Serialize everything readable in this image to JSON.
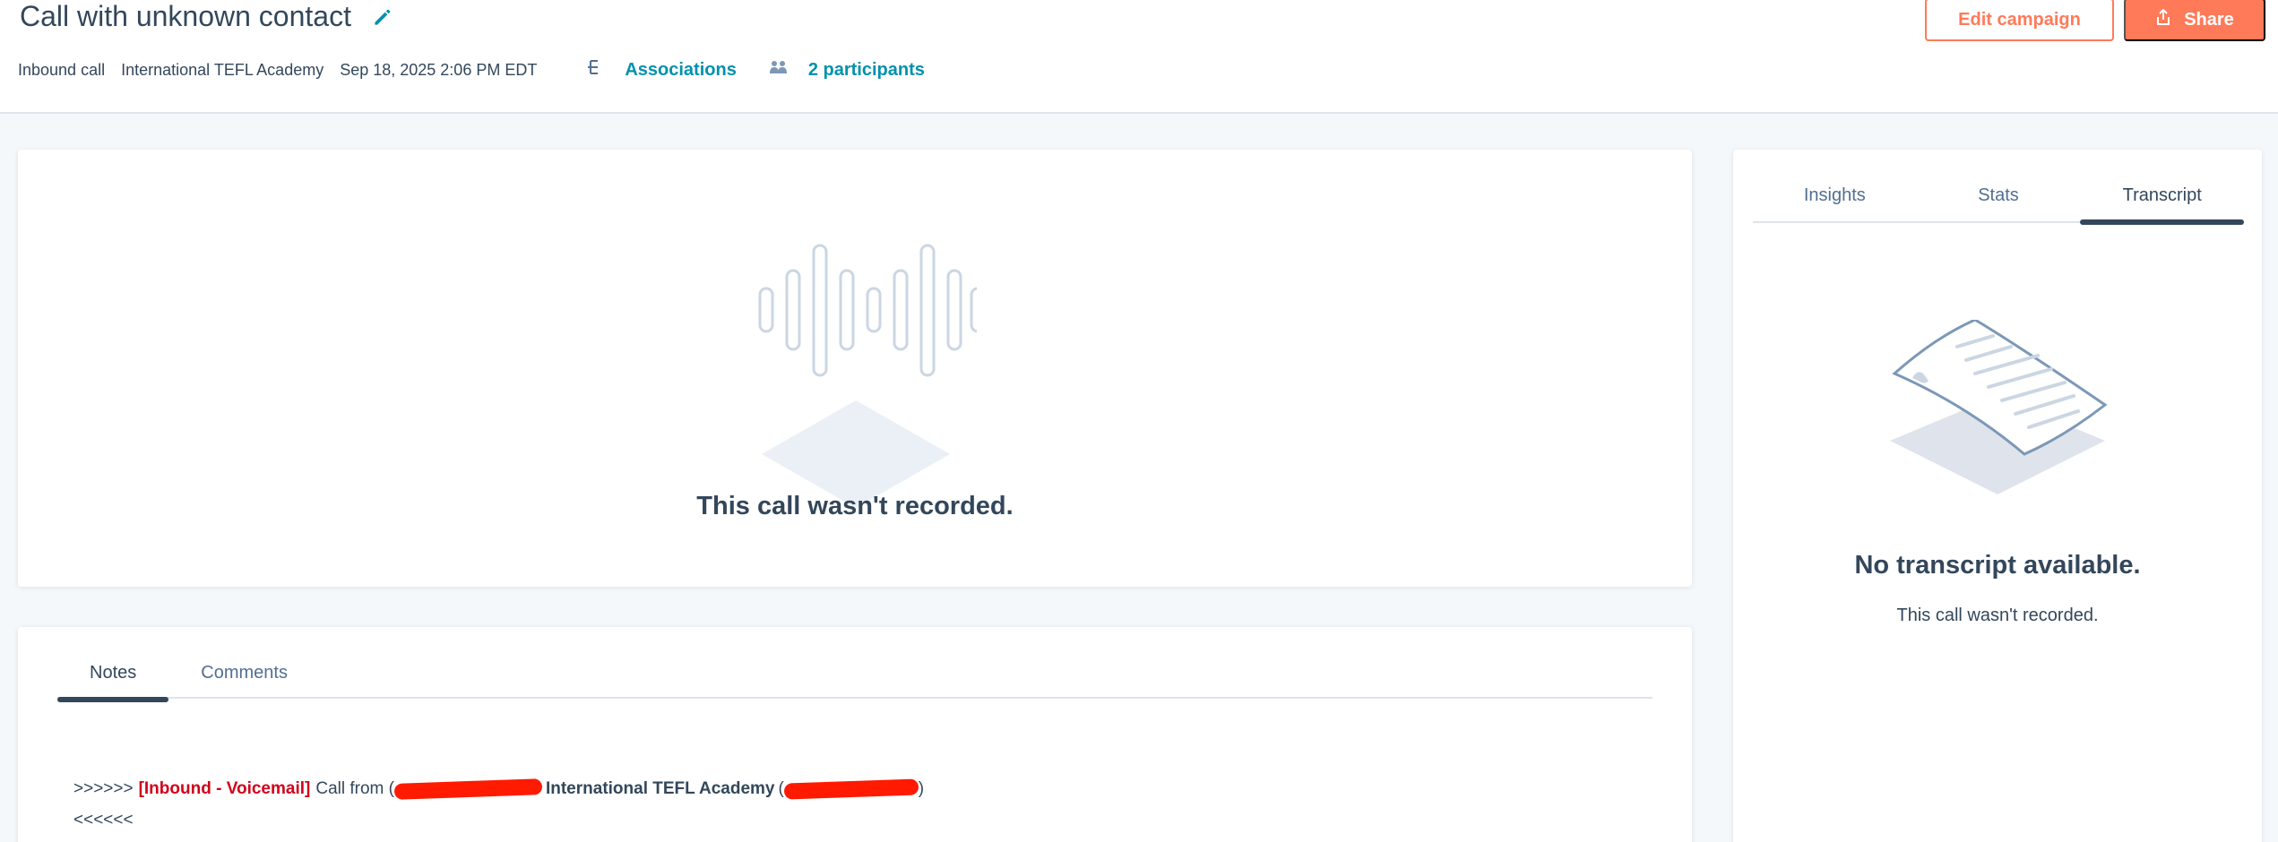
{
  "header": {
    "title": "Call with unknown contact",
    "meta": {
      "call_type": "Inbound call",
      "company": "International TEFL Academy",
      "timestamp": "Sep 18, 2025 2:06 PM EDT",
      "associations_label": "Associations",
      "participants_label": "2 participants"
    },
    "edit_campaign_label": "Edit campaign",
    "share_label": "Share"
  },
  "recording": {
    "message": "This call wasn't recorded."
  },
  "notes": {
    "tabs": [
      {
        "label": "Notes",
        "active": true
      },
      {
        "label": "Comments",
        "active": false
      }
    ],
    "line1": {
      "prefix": ">>>>>>",
      "tag": "[Inbound - Voicemail]",
      "text": "Call from (",
      "org": "International TEFL Academy",
      "open_paren": "(",
      "close": ")"
    },
    "line2": "<<<<<<"
  },
  "side": {
    "tabs": [
      {
        "label": "Insights",
        "active": false
      },
      {
        "label": "Stats",
        "active": false
      },
      {
        "label": "Transcript",
        "active": true
      }
    ],
    "title": "No transcript available.",
    "subtitle": "This call wasn't recorded."
  },
  "colors": {
    "accent": "#ff7a59",
    "link": "#0091ae",
    "text": "#33475b",
    "voicemail_tag": "#d0021b",
    "redaction": "#ff1a00"
  },
  "icons": {
    "title_edit": "pencil-icon",
    "associations": "associations-icon",
    "participants": "participants-icon",
    "share": "share-icon"
  }
}
